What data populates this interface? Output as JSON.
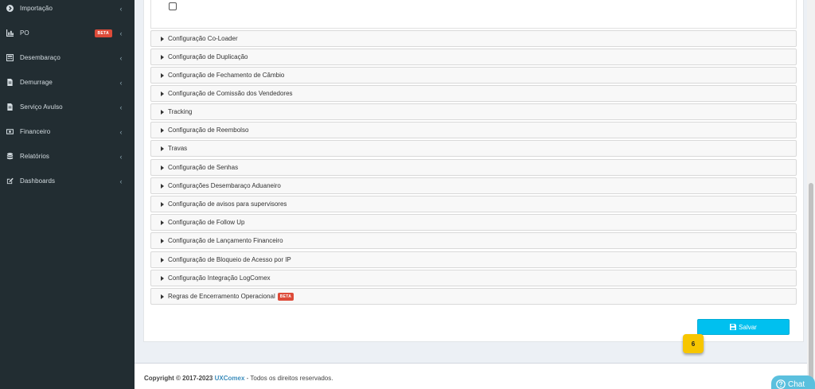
{
  "sidebar": {
    "items": [
      {
        "label": "Importação",
        "icon": "arrow-circle-right-icon"
      },
      {
        "label": "PO",
        "icon": "bar-chart-icon",
        "badge": "BETA"
      },
      {
        "label": "Desembaraço",
        "icon": "calculator-icon"
      },
      {
        "label": "Demurrage",
        "icon": "file-icon"
      },
      {
        "label": "Serviço Avulso",
        "icon": "file-icon"
      },
      {
        "label": "Financeiro",
        "icon": "money-icon"
      },
      {
        "label": "Relatórios",
        "icon": "database-icon"
      },
      {
        "label": "Dashboards",
        "icon": "edit-icon"
      }
    ],
    "chevron": "‹"
  },
  "accordion": [
    {
      "label": "Configuração Co-Loader"
    },
    {
      "label": "Configuração de Duplicação"
    },
    {
      "label": "Configuração de Fechamento de Câmbio"
    },
    {
      "label": "Configuração de Comissão dos Vendedores"
    },
    {
      "label": "Tracking"
    },
    {
      "label": "Configuração de Reembolso"
    },
    {
      "label": "Travas"
    },
    {
      "label": "Configuração de Senhas"
    },
    {
      "label": "Configurações Desembaraço Aduaneiro"
    },
    {
      "label": "Configuração de avisos para supervisores"
    },
    {
      "label": "Configuração de Follow Up"
    },
    {
      "label": "Configuração de Lançamento Financeiro"
    },
    {
      "label": "Configuração de Bloqueio de Acesso por IP"
    },
    {
      "label": "Configuração Integração LogComex"
    },
    {
      "label": "Regras de Encerramento Operacional",
      "badge": "BETA"
    }
  ],
  "save_button": {
    "label": "Salvar",
    "icon": "save-icon"
  },
  "step_badge": "6",
  "footer": {
    "copyright": "Copyright © 2017-2023",
    "brand": "UXComex",
    "rest": "- Todos os direitos reservados."
  },
  "chat": {
    "label": "Chat",
    "icon": "question-circle-icon"
  },
  "colors": {
    "sidebar_bg": "#222d32",
    "accent": "#00c0ef",
    "beta_badge": "#dd4b39",
    "step_badge": "#f7c600",
    "brand_link": "#3c8dbc"
  }
}
